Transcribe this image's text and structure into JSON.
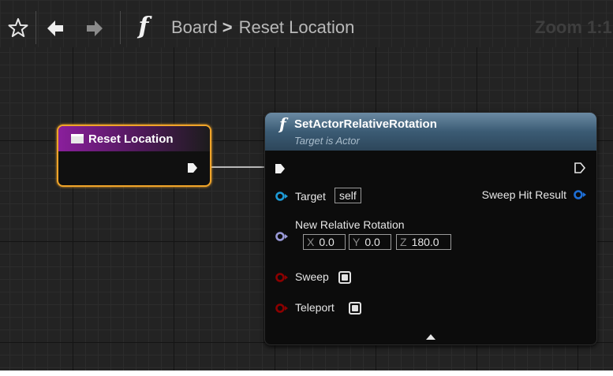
{
  "toolbar": {
    "breadcrumb_parent": "Board",
    "breadcrumb_separator": ">",
    "breadcrumb_current": "Reset Location",
    "zoom_label": "Zoom 1:1",
    "function_glyph": "f"
  },
  "event_node": {
    "title": "Reset Location"
  },
  "function_node": {
    "glyph": "f",
    "title": "SetActorRelativeRotation",
    "subtitle": "Target is Actor",
    "target_label": "Target",
    "target_value": "self",
    "sweep_hit_result_label": "Sweep Hit Result",
    "new_relative_rotation_label": "New Relative Rotation",
    "rotation": {
      "x_axis": "X",
      "x_value": "0.0",
      "y_axis": "Y",
      "y_value": "0.0",
      "z_axis": "Z",
      "z_value": "180.0"
    },
    "sweep_label": "Sweep",
    "teleport_label": "Teleport"
  },
  "colors": {
    "object_pin": "#1e9bd7",
    "struct_pin": "#9a9ad8",
    "bool_pin": "#8c0000",
    "event_border": "#f0a429",
    "event_header": "#8a1f9c",
    "function_header": "#4a6a84"
  }
}
